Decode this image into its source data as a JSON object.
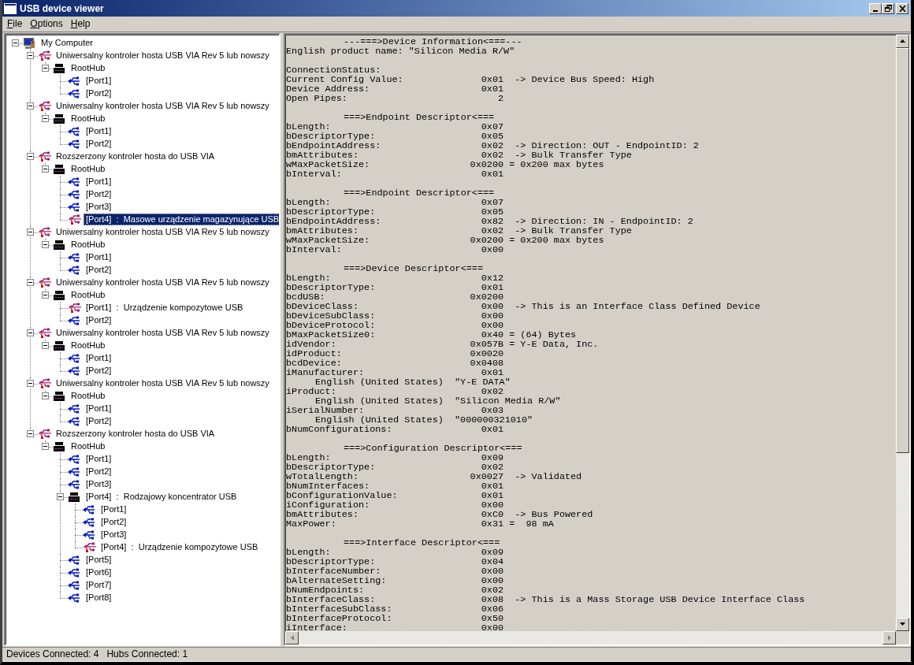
{
  "window": {
    "title": "USB device viewer"
  },
  "menu": [
    {
      "label": "File"
    },
    {
      "label": "Options"
    },
    {
      "label": "Help"
    }
  ],
  "tree": {
    "items": [
      {
        "label": "My Computer",
        "kind": "computer",
        "expanded": true,
        "selected": false,
        "children": [
          {
            "label": "Uniwersalny kontroler hosta USB VIA Rev 5 lub nowszy",
            "kind": "controller",
            "expanded": true,
            "selected": false,
            "children": [
              {
                "label": "RootHub",
                "kind": "hub",
                "expanded": true,
                "selected": false,
                "children": [
                  {
                    "label": "[Port1]",
                    "kind": "port",
                    "selected": false
                  },
                  {
                    "label": "[Port2]",
                    "kind": "port",
                    "selected": false
                  }
                ]
              }
            ]
          },
          {
            "label": "Uniwersalny kontroler hosta USB VIA Rev 5 lub nowszy",
            "kind": "controller",
            "expanded": true,
            "selected": false,
            "children": [
              {
                "label": "RootHub",
                "kind": "hub",
                "expanded": true,
                "selected": false,
                "children": [
                  {
                    "label": "[Port1]",
                    "kind": "port",
                    "selected": false
                  },
                  {
                    "label": "[Port2]",
                    "kind": "port",
                    "selected": false
                  }
                ]
              }
            ]
          },
          {
            "label": "Rozszerzony kontroler hosta do USB VIA",
            "kind": "controller",
            "expanded": true,
            "selected": false,
            "children": [
              {
                "label": "RootHub",
                "kind": "hub",
                "expanded": true,
                "selected": false,
                "children": [
                  {
                    "label": "[Port1]",
                    "kind": "port",
                    "selected": false
                  },
                  {
                    "label": "[Port2]",
                    "kind": "port",
                    "selected": false
                  },
                  {
                    "label": "[Port3]",
                    "kind": "port",
                    "selected": false
                  },
                  {
                    "label": "[Port4]  :  Masowe urządzenie magazynujące USB",
                    "kind": "device",
                    "selected": true
                  }
                ]
              }
            ]
          },
          {
            "label": "Uniwersalny kontroler hosta USB VIA Rev 5 lub nowszy",
            "kind": "controller",
            "expanded": true,
            "selected": false,
            "children": [
              {
                "label": "RootHub",
                "kind": "hub",
                "expanded": true,
                "selected": false,
                "children": [
                  {
                    "label": "[Port1]",
                    "kind": "port",
                    "selected": false
                  },
                  {
                    "label": "[Port2]",
                    "kind": "port",
                    "selected": false
                  }
                ]
              }
            ]
          },
          {
            "label": "Uniwersalny kontroler hosta USB VIA Rev 5 lub nowszy",
            "kind": "controller",
            "expanded": true,
            "selected": false,
            "children": [
              {
                "label": "RootHub",
                "kind": "hub",
                "expanded": true,
                "selected": false,
                "children": [
                  {
                    "label": "[Port1]  :  Urządzenie kompozytowe USB",
                    "kind": "device",
                    "selected": false
                  },
                  {
                    "label": "[Port2]",
                    "kind": "port",
                    "selected": false
                  }
                ]
              }
            ]
          },
          {
            "label": "Uniwersalny kontroler hosta USB VIA Rev 5 lub nowszy",
            "kind": "controller",
            "expanded": true,
            "selected": false,
            "children": [
              {
                "label": "RootHub",
                "kind": "hub",
                "expanded": true,
                "selected": false,
                "children": [
                  {
                    "label": "[Port1]",
                    "kind": "port",
                    "selected": false
                  },
                  {
                    "label": "[Port2]",
                    "kind": "port",
                    "selected": false
                  }
                ]
              }
            ]
          },
          {
            "label": "Uniwersalny kontroler hosta USB VIA Rev 5 lub nowszy",
            "kind": "controller",
            "expanded": true,
            "selected": false,
            "children": [
              {
                "label": "RootHub",
                "kind": "hub",
                "expanded": true,
                "selected": false,
                "children": [
                  {
                    "label": "[Port1]",
                    "kind": "port",
                    "selected": false
                  },
                  {
                    "label": "[Port2]",
                    "kind": "port",
                    "selected": false
                  }
                ]
              }
            ]
          },
          {
            "label": "Rozszerzony kontroler hosta do USB VIA",
            "kind": "controller",
            "expanded": true,
            "selected": false,
            "children": [
              {
                "label": "RootHub",
                "kind": "hub",
                "expanded": true,
                "selected": false,
                "children": [
                  {
                    "label": "[Port1]",
                    "kind": "port",
                    "selected": false
                  },
                  {
                    "label": "[Port2]",
                    "kind": "port",
                    "selected": false
                  },
                  {
                    "label": "[Port3]",
                    "kind": "port",
                    "selected": false
                  },
                  {
                    "label": "[Port4]  :  Rodzajowy koncentrator USB",
                    "kind": "hub",
                    "expanded": true,
                    "selected": false,
                    "children": [
                      {
                        "label": "[Port1]",
                        "kind": "port",
                        "selected": false
                      },
                      {
                        "label": "[Port2]",
                        "kind": "port",
                        "selected": false
                      },
                      {
                        "label": "[Port3]",
                        "kind": "port",
                        "selected": false
                      },
                      {
                        "label": "[Port4]  :  Urządzenie kompozytowe USB",
                        "kind": "device",
                        "selected": false
                      }
                    ]
                  },
                  {
                    "label": "[Port5]",
                    "kind": "port",
                    "selected": false
                  },
                  {
                    "label": "[Port6]",
                    "kind": "port",
                    "selected": false
                  },
                  {
                    "label": "[Port7]",
                    "kind": "port",
                    "selected": false
                  },
                  {
                    "label": "[Port8]",
                    "kind": "port",
                    "selected": false
                  }
                ]
              }
            ]
          }
        ]
      }
    ]
  },
  "report": {
    "blocks": [
      [
        {
          "kind": "heading",
          "text": "---===>Device Information<===---"
        },
        {
          "kind": "line",
          "text": "English product name: \"Silicon Media R/W\""
        }
      ],
      [
        {
          "kind": "line",
          "text": "ConnectionStatus:"
        },
        {
          "kind": "line",
          "text": "Current Config Value:              0x01  -> Device Bus Speed: High"
        },
        {
          "kind": "line",
          "text": "Device Address:                    0x01"
        },
        {
          "kind": "line",
          "text": "Open Pipes:                           2"
        }
      ],
      [
        {
          "kind": "heading",
          "text": "===>Endpoint Descriptor<==="
        },
        {
          "kind": "line",
          "text": "bLength:                           0x07"
        },
        {
          "kind": "line",
          "text": "bDescriptorType:                   0x05"
        },
        {
          "kind": "line",
          "text": "bEndpointAddress:                  0x02  -> Direction: OUT - EndpointID: 2"
        },
        {
          "kind": "line",
          "text": "bmAttributes:                      0x02  -> Bulk Transfer Type"
        },
        {
          "kind": "line",
          "text": "wMaxPacketSize:                  0x0200 = 0x200 max bytes"
        },
        {
          "kind": "line",
          "text": "bInterval:                         0x01"
        }
      ],
      [
        {
          "kind": "heading",
          "text": "===>Endpoint Descriptor<==="
        },
        {
          "kind": "line",
          "text": "bLength:                           0x07"
        },
        {
          "kind": "line",
          "text": "bDescriptorType:                   0x05"
        },
        {
          "kind": "line",
          "text": "bEndpointAddress:                  0x82  -> Direction: IN - EndpointID: 2"
        },
        {
          "kind": "line",
          "text": "bmAttributes:                      0x02  -> Bulk Transfer Type"
        },
        {
          "kind": "line",
          "text": "wMaxPacketSize:                  0x0200 = 0x200 max bytes"
        },
        {
          "kind": "line",
          "text": "bInterval:                         0x00"
        }
      ],
      [
        {
          "kind": "heading",
          "text": "===>Device Descriptor<==="
        },
        {
          "kind": "line",
          "text": "bLength:                           0x12"
        },
        {
          "kind": "line",
          "text": "bDescriptorType:                   0x01"
        },
        {
          "kind": "line",
          "text": "bcdUSB:                          0x0200"
        },
        {
          "kind": "line",
          "text": "bDeviceClass:                      0x00  -> This is an Interface Class Defined Device"
        },
        {
          "kind": "line",
          "text": "bDeviceSubClass:                   0x00"
        },
        {
          "kind": "line",
          "text": "bDeviceProtocol:                   0x00"
        },
        {
          "kind": "line",
          "text": "bMaxPacketSize0:                   0x40 = (64) Bytes"
        },
        {
          "kind": "line",
          "text": "idVendor:                        0x057B = Y-E Data, Inc."
        },
        {
          "kind": "line",
          "text": "idProduct:                       0x0020"
        },
        {
          "kind": "line",
          "text": "bcdDevice:                       0x0408"
        },
        {
          "kind": "line",
          "text": "iManufacturer:                     0x01"
        },
        {
          "kind": "sub",
          "text": "English (United States)  \"Y-E DATA\""
        },
        {
          "kind": "line",
          "text": "iProduct:                          0x02"
        },
        {
          "kind": "sub",
          "text": "English (United States)  \"Silicon Media R/W\""
        },
        {
          "kind": "line",
          "text": "iSerialNumber:                     0x03"
        },
        {
          "kind": "sub",
          "text": "English (United States)  \"000000321010\""
        },
        {
          "kind": "line",
          "text": "bNumConfigurations:                0x01"
        }
      ],
      [
        {
          "kind": "heading",
          "text": "===>Configuration Descriptor<==="
        },
        {
          "kind": "line",
          "text": "bLength:                           0x09"
        },
        {
          "kind": "line",
          "text": "bDescriptorType:                   0x02"
        },
        {
          "kind": "line",
          "text": "wTotalLength:                    0x0027  -> Validated"
        },
        {
          "kind": "line",
          "text": "bNumInterfaces:                    0x01"
        },
        {
          "kind": "line",
          "text": "bConfigurationValue:               0x01"
        },
        {
          "kind": "line",
          "text": "iConfiguration:                    0x00"
        },
        {
          "kind": "line",
          "text": "bmAttributes:                      0xC0  -> Bus Powered"
        },
        {
          "kind": "line",
          "text": "MaxPower:                          0x31 =  98 mA"
        }
      ],
      [
        {
          "kind": "heading",
          "text": "===>Interface Descriptor<==="
        },
        {
          "kind": "line",
          "text": "bLength:                           0x09"
        },
        {
          "kind": "line",
          "text": "bDescriptorType:                   0x04"
        },
        {
          "kind": "line",
          "text": "bInterfaceNumber:                  0x00"
        },
        {
          "kind": "line",
          "text": "bAlternateSetting:                 0x00"
        },
        {
          "kind": "line",
          "text": "bNumEndpoints:                     0x02"
        },
        {
          "kind": "line",
          "text": "bInterfaceClass:                   0x08  -> This is a Mass Storage USB Device Interface Class"
        },
        {
          "kind": "line",
          "text": "bInterfaceSubClass:                0x06"
        },
        {
          "kind": "line",
          "text": "bInterfaceProtocol:                0x50"
        },
        {
          "kind": "line",
          "text": "iInterface:                        0x00"
        }
      ]
    ]
  },
  "status_bar": [
    "Devices Connected: 4",
    "Hubs Connected: 1"
  ]
}
